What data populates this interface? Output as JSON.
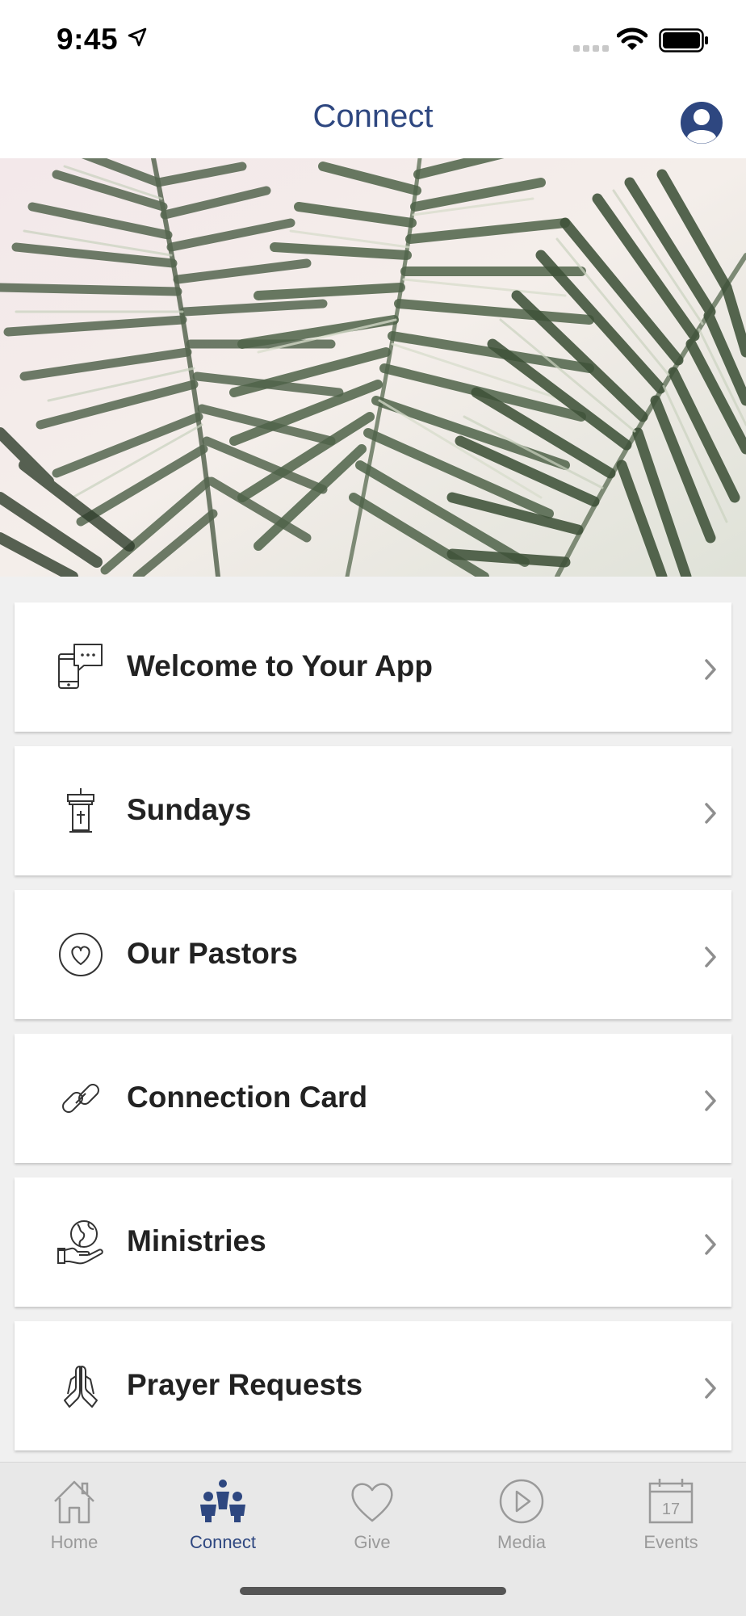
{
  "status_bar": {
    "time": "9:45"
  },
  "nav": {
    "title": "Connect"
  },
  "menu": {
    "items": [
      {
        "label": "Welcome to Your App",
        "icon": "phone-chat-icon"
      },
      {
        "label": "Sundays",
        "icon": "pulpit-icon"
      },
      {
        "label": "Our Pastors",
        "icon": "heart-circle-icon"
      },
      {
        "label": "Connection Card",
        "icon": "link-icon"
      },
      {
        "label": "Ministries",
        "icon": "globe-hand-icon"
      },
      {
        "label": "Prayer Requests",
        "icon": "praying-hands-icon"
      }
    ]
  },
  "tabs": [
    {
      "label": "Home",
      "icon": "home-icon",
      "active": false
    },
    {
      "label": "Connect",
      "icon": "people-icon",
      "active": true
    },
    {
      "label": "Give",
      "icon": "heart-icon",
      "active": false
    },
    {
      "label": "Media",
      "icon": "play-circle-icon",
      "active": false
    },
    {
      "label": "Events",
      "icon": "calendar-icon",
      "active": false,
      "badge": "17"
    }
  ],
  "colors": {
    "accent": "#2e4780",
    "inactive": "#9a9a9a",
    "list_background": "#f0f0f0",
    "tab_background": "#e8e8e8"
  }
}
